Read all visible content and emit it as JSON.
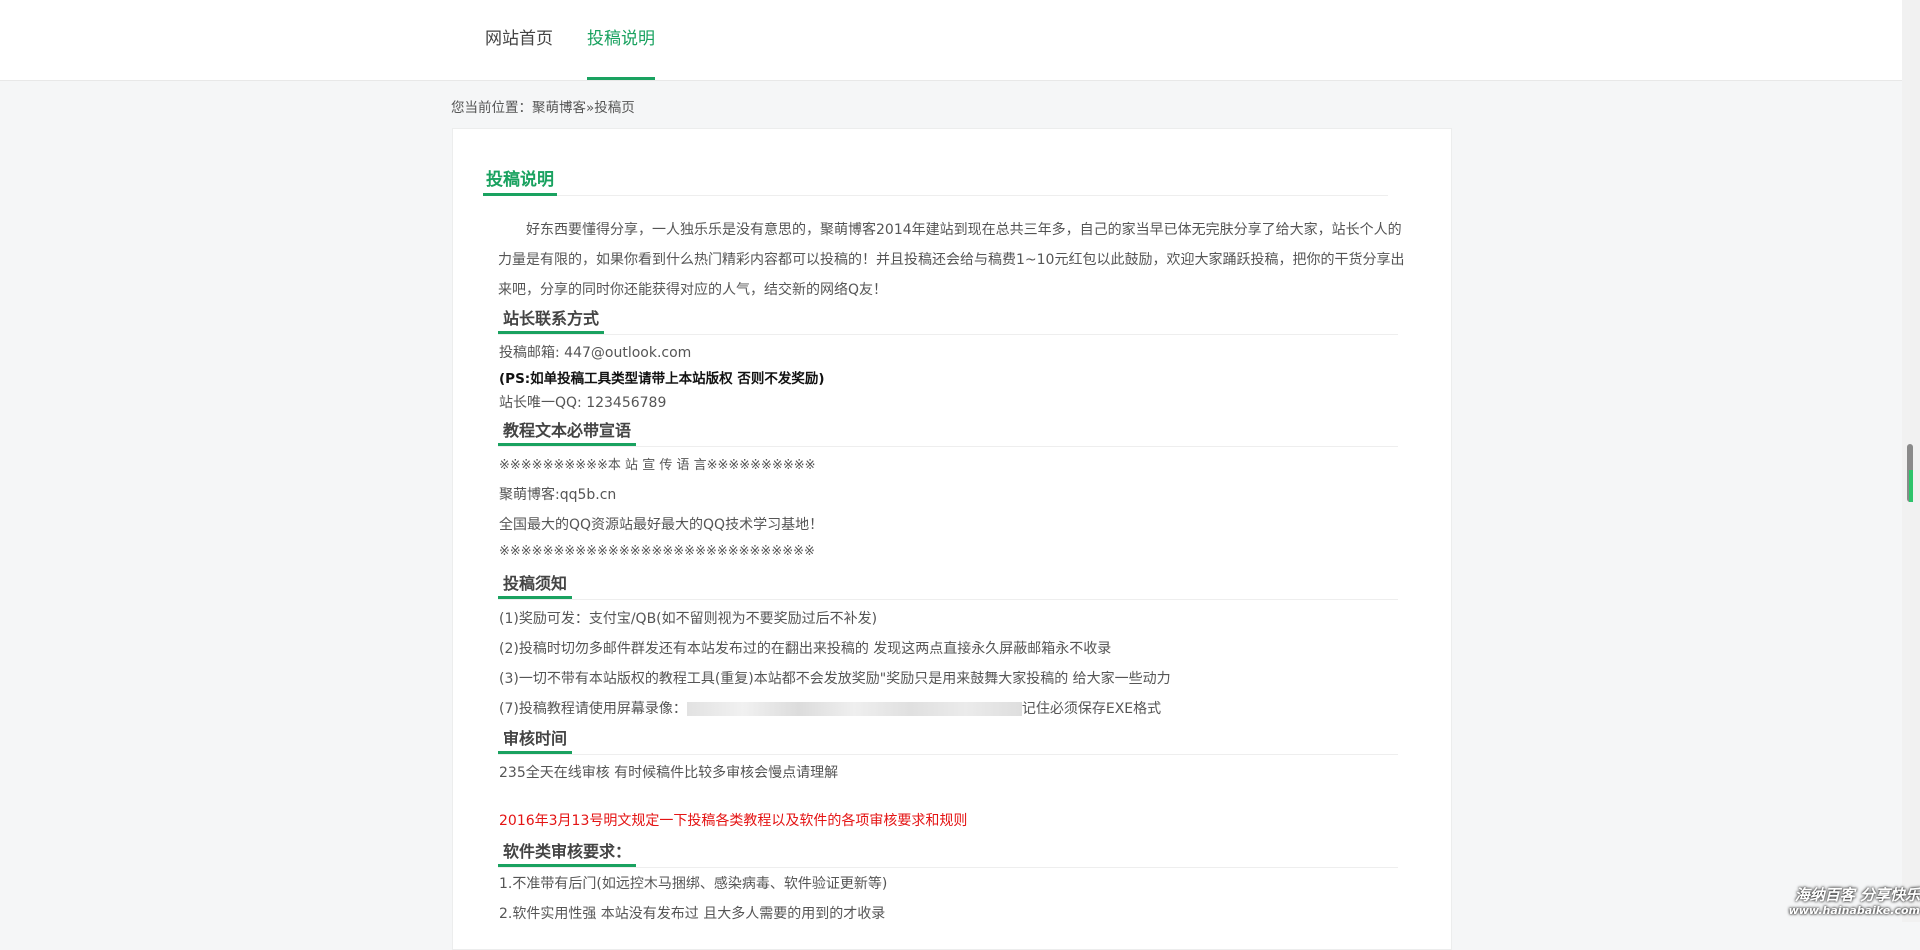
{
  "nav": {
    "home": "网站首页",
    "guide": "投稿说明"
  },
  "breadcrumb": {
    "prefix": "您当前位置：",
    "site": "聚萌博客",
    "sep": "»",
    "current": "投稿页"
  },
  "content": {
    "title": "投稿说明",
    "intro": "好东西要懂得分享，一人独乐乐是没有意思的，聚萌博客2014年建站到现在总共三年多，自己的家当早已体无完肤分享了给大家，站长个人的力量是有限的，如果你看到什么热门精彩内容都可以投稿的！并且投稿还会给与稿费1~10元红包以此鼓励，欢迎大家踊跃投稿，把你的干货分享出来吧，分享的同时你还能获得对应的人气，结交新的网络Q友！",
    "contact": {
      "title": "站长联系方式",
      "email": "投稿邮箱: 447@outlook.com",
      "ps": "(PS:如单投稿工具类型请带上本站版权 否则不发奖励)",
      "qq": "站长唯一QQ: 123456789"
    },
    "slogan": {
      "title": "教程文本必带宣语",
      "lines": [
        "※※※※※※※※※※本 站 宣 传 语 言※※※※※※※※※※",
        "聚萌博客:qq5b.cn",
        "全国最大的QQ资源站最好最大的QQ技术学习基地！",
        "※※※※※※※※※※※※※※※※※※※※※※※※※※※※※"
      ]
    },
    "notice": {
      "title": "投稿须知",
      "lines": [
        "(1)奖励可发：支付宝/QB(如不留则视为不要奖励过后不补发)",
        "(2)投稿时切勿多邮件群发还有本站发布过的在翻出来投稿的 发现这两点直接永久屏蔽邮箱永不收录",
        "(3)一切不带有本站版权的教程工具(重复)本站都不会发放奖励\"奖励只是用来鼓舞大家投稿的 给大家一些动力"
      ],
      "line7_prefix": "(7)投稿教程请使用屏幕录像：",
      "line7_suffix": "记住必须保存EXE格式"
    },
    "review": {
      "title": "审核时间",
      "text": "235全天在线审核 有时候稿件比较多审核会慢点请理解"
    },
    "announcement": "2016年3月13号明文规定一下投稿各类教程以及软件的各项审核要求和规则",
    "software": {
      "title": "软件类审核要求：",
      "lines": [
        "1.不准带有后门(如远控木马捆绑、感染病毒、软件验证更新等)",
        "2.软件实用性强 本站没有发布过 且大多人需要的用到的才收录"
      ]
    }
  },
  "watermark": {
    "line1": "海纳百客 分享快乐",
    "line2": "www.hainabaike.com"
  },
  "colors": {
    "accent": "#1aa260",
    "announcement": "#e41414"
  }
}
